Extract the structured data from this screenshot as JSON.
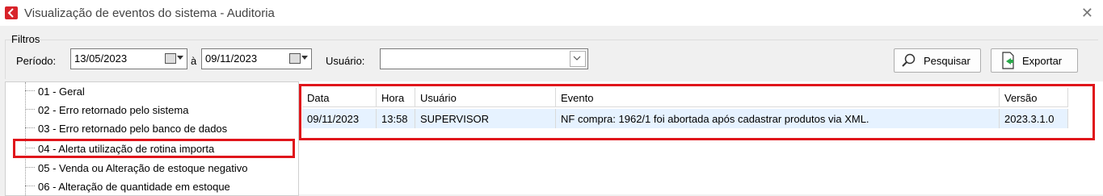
{
  "window": {
    "title": "Visualização de eventos do sistema - Auditoria",
    "close_glyph": "✕",
    "app_icon": "app-logo-icon"
  },
  "filters": {
    "group_label": "Filtros",
    "periodo_label": "Período:",
    "date_from": "13/05/2023",
    "between_label": "à",
    "date_to": "09/11/2023",
    "usuario_label": "Usuário:",
    "usuario_value": "",
    "pesquisar_label": "Pesquisar",
    "exportar_label": "Exportar"
  },
  "tree": {
    "items": [
      "01 - Geral",
      "02 - Erro retornado pelo sistema",
      "03 - Erro retornado pelo banco de dados",
      "04 - Alerta utilização de rotina importa",
      "05 - Venda ou Alteração de estoque negativo",
      "06 - Alteração de quantidade em estoque"
    ],
    "highlighted_index": 3
  },
  "table": {
    "columns": [
      "Data",
      "Hora",
      "Usuário",
      "Evento",
      "Versão"
    ],
    "rows": [
      [
        "09/11/2023",
        "13:58",
        "SUPERVISOR",
        "NF compra: 1962/1 foi abortada após cadastrar produtos via XML.",
        "2023.3.1.0"
      ]
    ]
  },
  "colors": {
    "highlight": "#e0151b",
    "selected_row": "#e6f2ff",
    "app_icon": "#d8232a"
  }
}
